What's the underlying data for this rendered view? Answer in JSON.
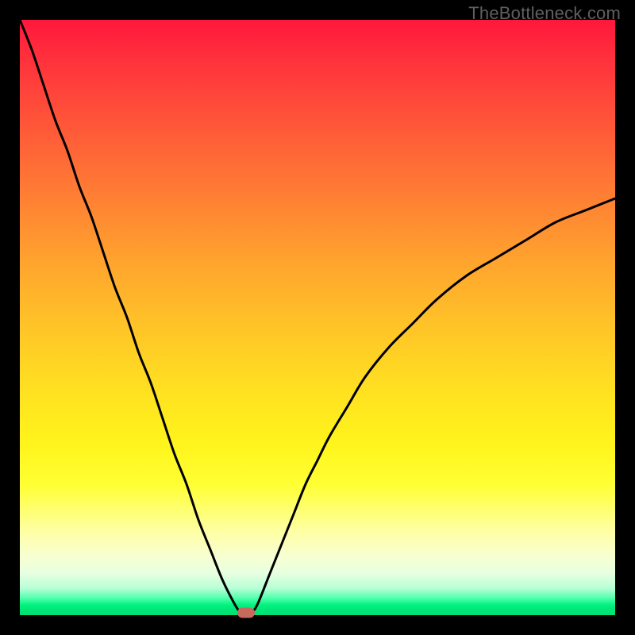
{
  "watermark": "TheBottleneck.com",
  "colors": {
    "frame": "#000000",
    "curve": "#000000",
    "marker": "#c66a5d",
    "gradient_top": "#ff173c",
    "gradient_bottom": "#00e073"
  },
  "chart_data": {
    "type": "line",
    "title": "",
    "xlabel": "",
    "ylabel": "",
    "xlim": [
      0,
      100
    ],
    "ylim": [
      0,
      100
    ],
    "x": [
      0,
      2,
      4,
      6,
      8,
      10,
      12,
      14,
      16,
      18,
      20,
      22,
      24,
      26,
      28,
      30,
      32,
      34,
      36,
      37,
      38,
      39,
      40,
      42,
      44,
      46,
      48,
      50,
      52,
      55,
      58,
      62,
      66,
      70,
      75,
      80,
      85,
      90,
      95,
      100
    ],
    "values": [
      100,
      95,
      89,
      83,
      78,
      72,
      67,
      61,
      55,
      50,
      44,
      39,
      33,
      27,
      22,
      16,
      11,
      6,
      2,
      0.5,
      0,
      0.5,
      2,
      7,
      12,
      17,
      22,
      26,
      30,
      35,
      40,
      45,
      49,
      53,
      57,
      60,
      63,
      66,
      68,
      70
    ],
    "marker": {
      "x": 38,
      "y": 0
    },
    "annotations": []
  }
}
